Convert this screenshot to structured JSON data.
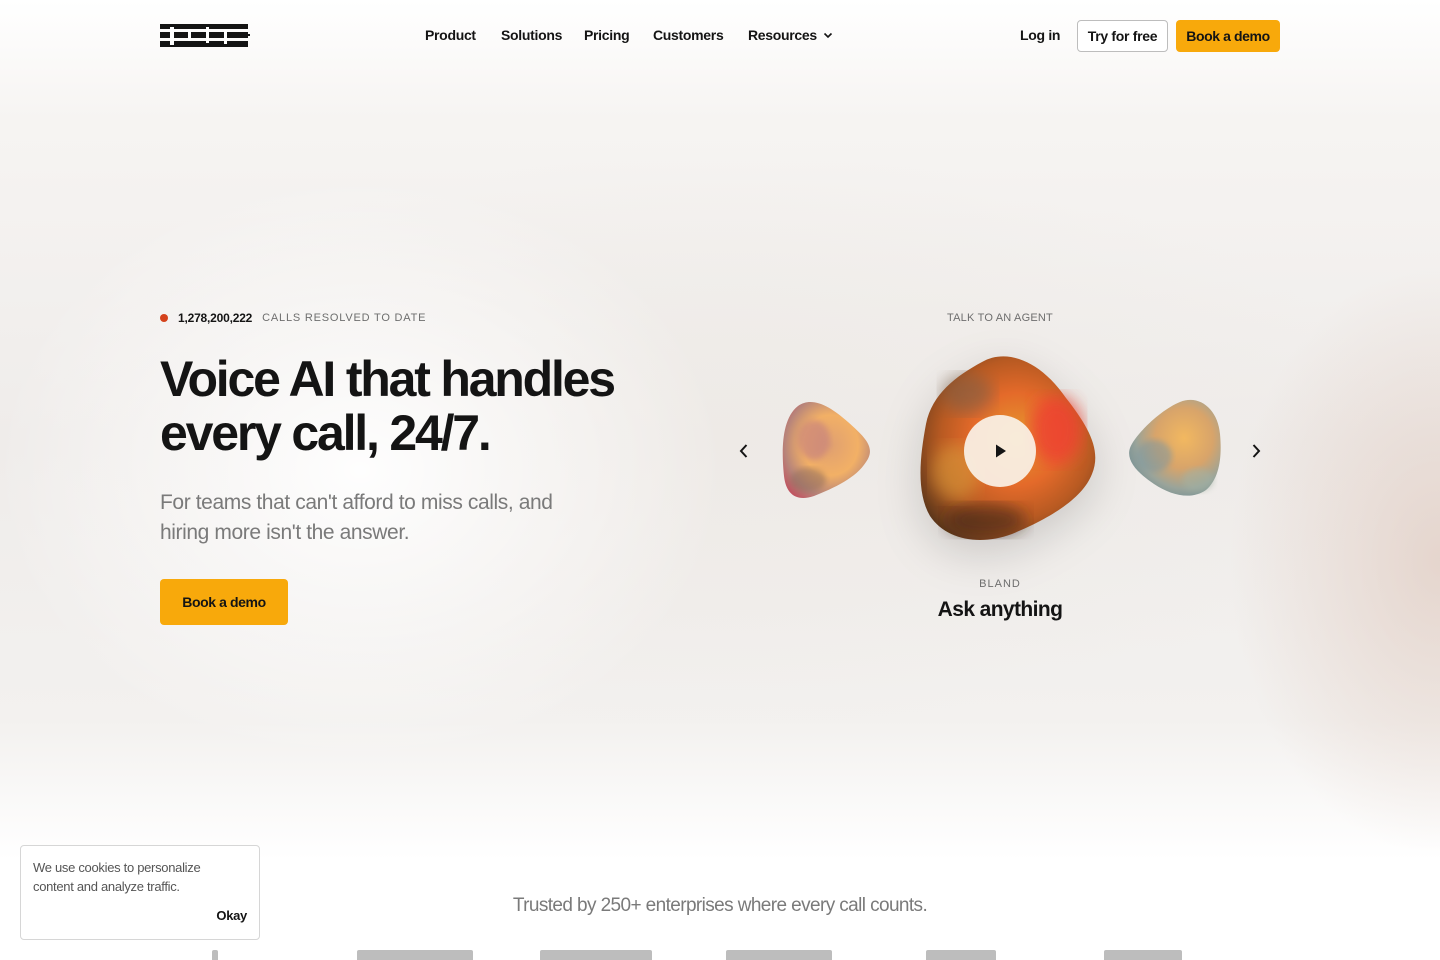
{
  "nav": {
    "items": [
      "Product",
      "Solutions",
      "Pricing",
      "Customers",
      "Resources"
    ],
    "login": "Log in",
    "try_free": "Try for free",
    "book_demo": "Book a demo"
  },
  "hero": {
    "stat_number": "1,278,200,222",
    "stat_label": "CALLS RESOLVED TO DATE",
    "title_line1": "Voice AI that handles",
    "title_line2": "every call, 24/7.",
    "subtitle": "For teams that can't afford to miss calls, and hiring more isn't the answer.",
    "cta": "Book a demo"
  },
  "agent": {
    "label": "TALK TO AN AGENT",
    "brand": "BLAND",
    "name": "Ask anything"
  },
  "trusted": {
    "text": "Trusted by 250+ enterprises where every call counts."
  },
  "cookie": {
    "text": "We use cookies to personalize content and analyze traffic.",
    "ok": "Okay"
  },
  "colors": {
    "accent": "#f8a90b",
    "stat_dot": "#d4421c",
    "text": "#141414",
    "muted": "#7a7a7a"
  },
  "icons": [
    "bland-logo",
    "chevron-down-icon",
    "chevron-left-icon",
    "chevron-right-icon",
    "play-icon"
  ]
}
